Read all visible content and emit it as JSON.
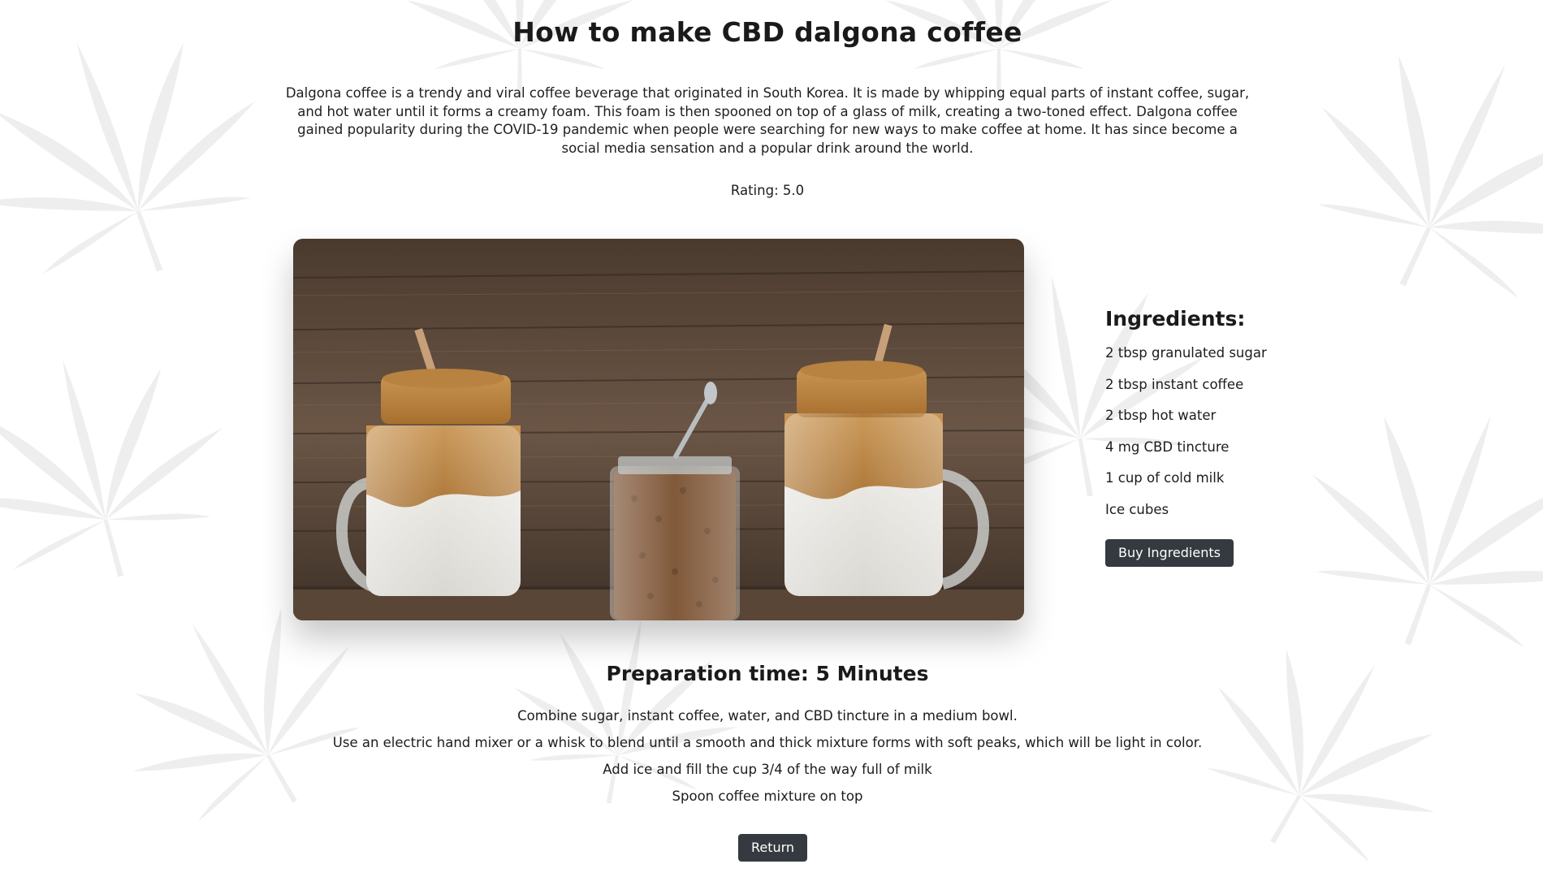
{
  "recipe": {
    "title": "How to make CBD dalgona coffee",
    "intro": "Dalgona coffee is a trendy and viral coffee beverage that originated in South Korea. It is made by whipping equal parts of instant coffee, sugar, and hot water until it forms a creamy foam. This foam is then spooned on top of a glass of milk, creating a two-toned effect.  Dalgona coffee gained popularity during the COVID-19 pandemic when people were searching for new ways to make coffee at home. It has since become a social media sensation and a popular drink around the world.",
    "rating": "Rating: 5.0",
    "image_alt": "dalgona-coffee-photo"
  },
  "ingredients": {
    "heading": "Ingredients:",
    "items": [
      "2 tbsp granulated sugar",
      "2 tbsp instant coffee",
      "2 tbsp hot water",
      "4 mg CBD tincture",
      "1 cup of cold milk",
      "Ice cubes"
    ],
    "buy_label": "Buy Ingredients"
  },
  "preparation": {
    "heading": "Preparation time: 5 Minutes",
    "steps": [
      "Combine sugar, instant coffee, water, and CBD tincture in a medium bowl.",
      "Use an electric hand mixer or a whisk to blend until a smooth and thick mixture forms with soft peaks, which will be light in color.",
      "Add ice and fill the cup 3/4 of the way full of milk",
      "Spoon coffee mixture on top"
    ]
  },
  "actions": {
    "return_label": "Return"
  },
  "colors": {
    "button_bg": "#343a40",
    "button_text": "#ffffff",
    "text": "#1c1c1c",
    "background": "#ffffff"
  }
}
